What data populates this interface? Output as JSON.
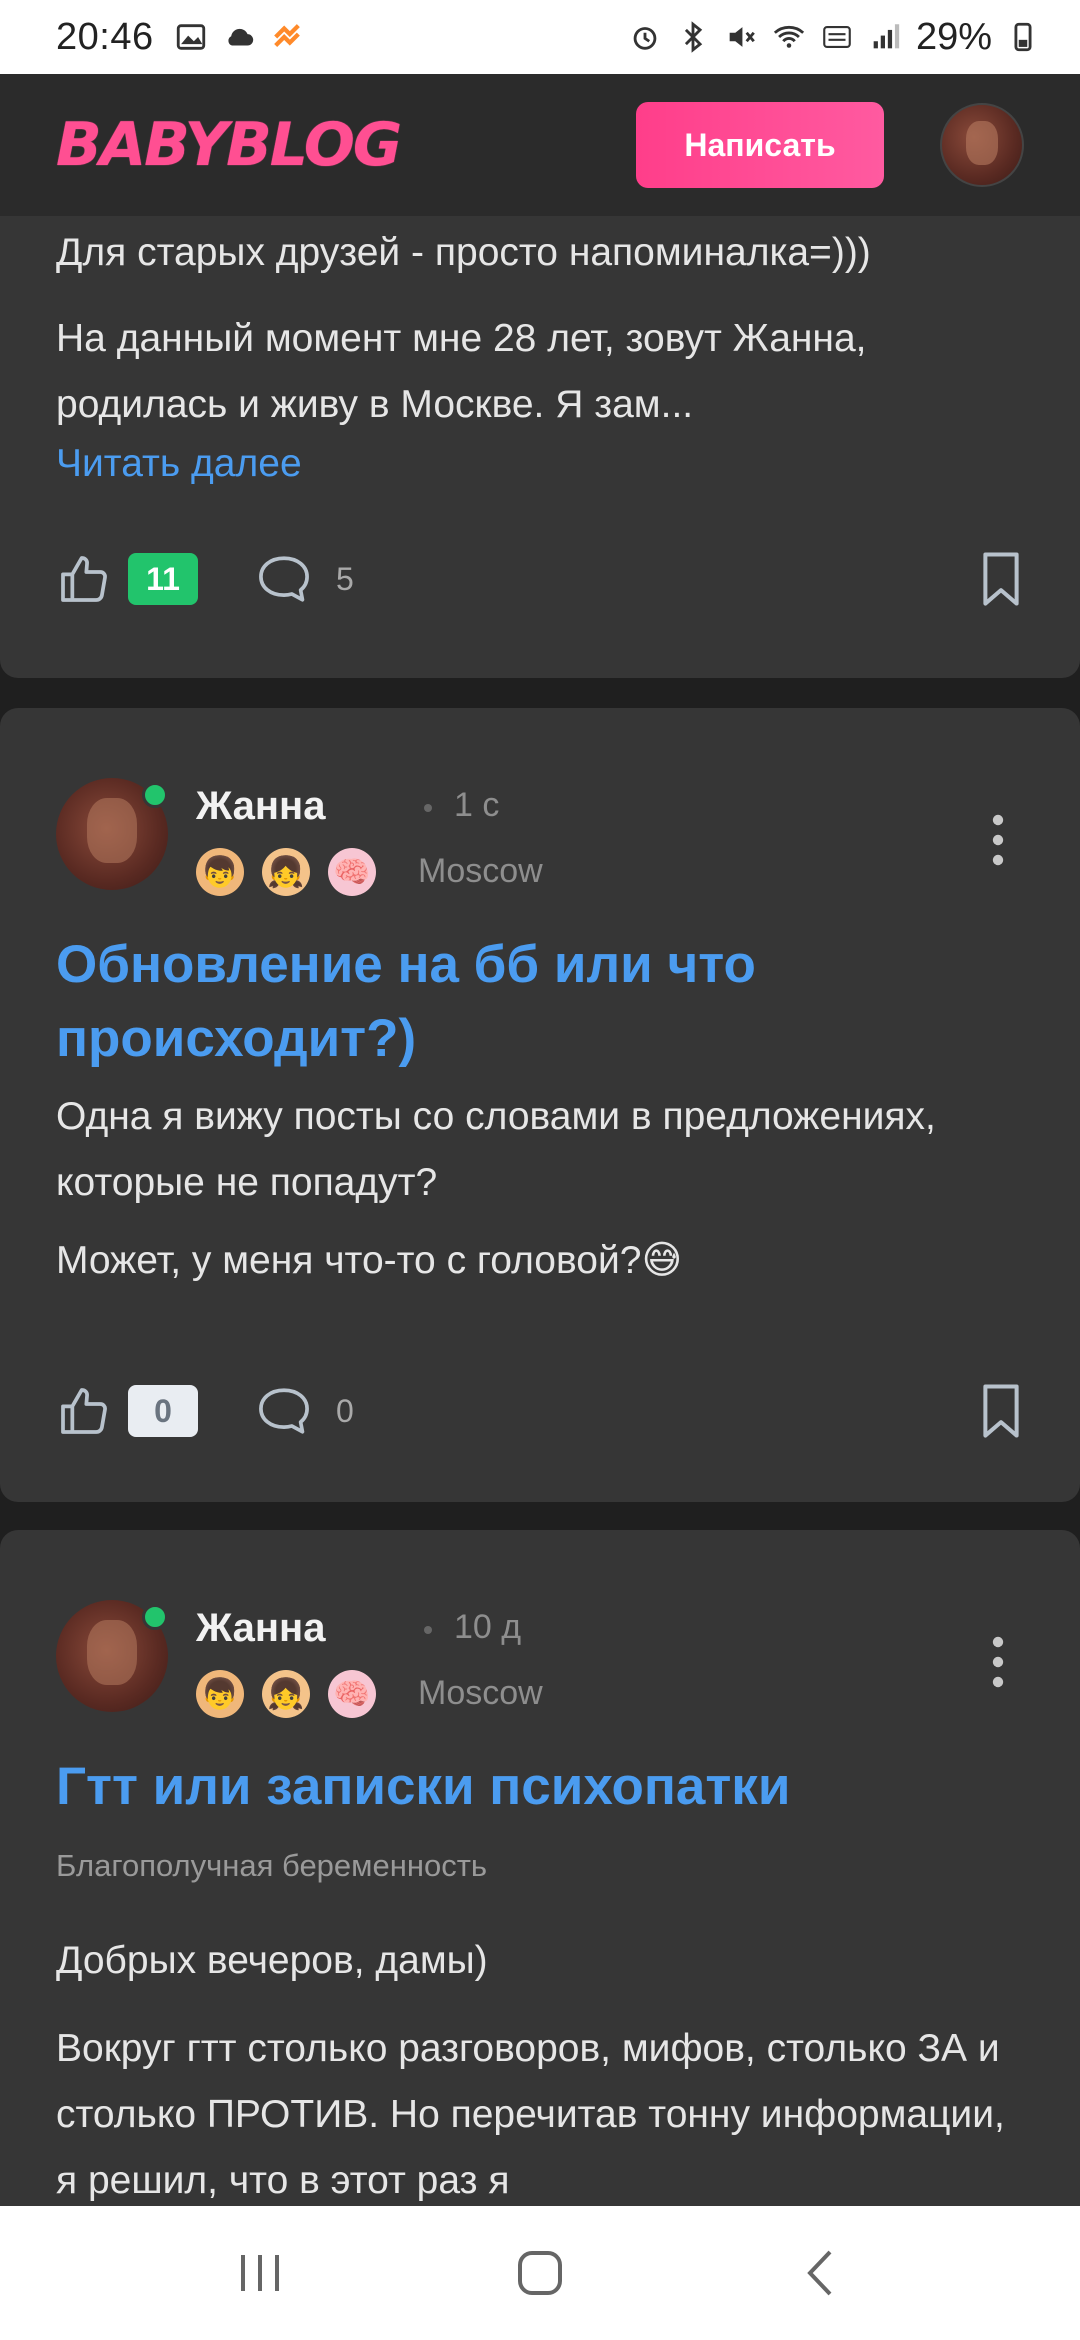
{
  "status_bar": {
    "time": "20:46",
    "battery": "29%"
  },
  "header": {
    "logo": "BABYBLOG",
    "write_button": "Написать"
  },
  "posts": [
    {
      "paragraphs": [
        "Для старых друзей - просто напоминалка=)))",
        "На данный момент мне 28 лет, зовут Жанна, родилась и живу в Москве. Я зам..."
      ],
      "read_more": "Читать далее",
      "likes": "11",
      "comments": "5"
    },
    {
      "author": "Жанна",
      "time": "1 с",
      "location": "Moscow",
      "title": "Обновление на бб или что происходит?)",
      "paragraphs": [
        "Одна я вижу посты со словами в предложениях, которые не попадут?",
        "Может, у меня что-то с головой?😅"
      ],
      "likes": "0",
      "comments": "0"
    },
    {
      "author": "Жанна",
      "time": "10 д",
      "location": "Moscow",
      "title": "Гтт или записки психопатки",
      "category": "Благополучная беременность",
      "paragraphs": [
        "Добрых вечеров, дамы)",
        "Вокруг гтт столько разговоров, мифов, столько ЗА и столько ПРОТИВ. Но перечитав тонну информации, я решил, что в этот раз я"
      ]
    }
  ],
  "icons": {
    "like": "thumbs-up-icon",
    "comment": "comment-bubble-icon",
    "bookmark": "bookmark-icon",
    "more": "more-vertical-icon"
  },
  "colors": {
    "accent_pink": "#ff4f92",
    "link_blue": "#4b9cf0",
    "likes_green": "#22c46c",
    "card_bg": "#363636"
  }
}
